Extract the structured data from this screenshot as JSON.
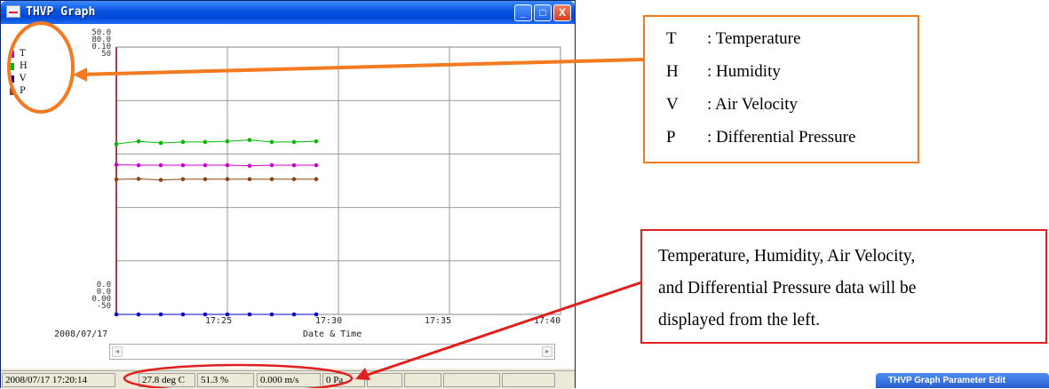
{
  "window": {
    "title": "THVP Graph",
    "buttons": {
      "minimize": "_",
      "maximize": "□",
      "close": "X"
    }
  },
  "graph": {
    "y_axis_top": [
      "50.0",
      "80.0",
      "0.10",
      "50"
    ],
    "y_axis_bottom": [
      "0.0",
      "0.0",
      "0.00",
      "-50"
    ],
    "legend": [
      {
        "key": "T",
        "color": "#cc00cc"
      },
      {
        "key": "H",
        "color": "#00bb00"
      },
      {
        "key": "V",
        "color": "#0000cc"
      },
      {
        "key": "P",
        "color": "#8b4513"
      }
    ],
    "x_ticks": [
      "17:25",
      "17:30",
      "17:35",
      "17:40"
    ],
    "date_label": "2008/07/17",
    "x_axis_label": "Date & Time"
  },
  "chart_data": {
    "type": "line",
    "x": [
      "17:20",
      "17:21",
      "17:22",
      "17:23",
      "17:24",
      "17:25",
      "17:26",
      "17:27",
      "17:28",
      "17:29"
    ],
    "xlim": [
      "17:20",
      "17:40"
    ],
    "series": [
      {
        "name": "T",
        "color": "#cc00cc",
        "values": [
          28.0,
          27.9,
          27.9,
          27.9,
          27.9,
          27.9,
          27.8,
          27.9,
          27.9,
          27.9
        ],
        "ylim": [
          0,
          50
        ]
      },
      {
        "name": "H",
        "color": "#00bb00",
        "values": [
          51.0,
          51.8,
          51.3,
          51.6,
          51.6,
          51.8,
          52.2,
          51.6,
          51.6,
          51.8
        ],
        "ylim": [
          0,
          80
        ]
      },
      {
        "name": "V",
        "color": "#0000cc",
        "values": [
          0,
          0,
          0,
          0,
          0,
          0,
          0,
          0,
          0,
          0
        ],
        "ylim": [
          0,
          0.1
        ]
      },
      {
        "name": "P",
        "color": "#8b4513",
        "values": [
          0.5,
          0.7,
          0.3,
          0.6,
          0.6,
          0.6,
          0.6,
          0.6,
          0.6,
          0.6
        ],
        "ylim": [
          -50,
          50
        ]
      }
    ]
  },
  "statusbar": {
    "datetime": "2008/07/17 17:20:14",
    "temperature": "27.8 deg C",
    "humidity": "51.3 %",
    "velocity": "0.000 m/s",
    "pressure": "0 Pa"
  },
  "legend_box": {
    "rows": [
      {
        "key": "T",
        "text": ": Temperature"
      },
      {
        "key": "H",
        "text": ": Humidity"
      },
      {
        "key": "V",
        "text": ": Air Velocity"
      },
      {
        "key": "P",
        "text": ": Differential Pressure"
      }
    ]
  },
  "note_box": {
    "lines": [
      "Temperature, Humidity, Air Velocity,",
      "and Differential Pressure data will be",
      "displayed from the left."
    ]
  },
  "taskbar": {
    "button": "THVP Graph Parameter Edit"
  },
  "colors": {
    "orange": "#f47a20",
    "red": "#e21f1f"
  }
}
